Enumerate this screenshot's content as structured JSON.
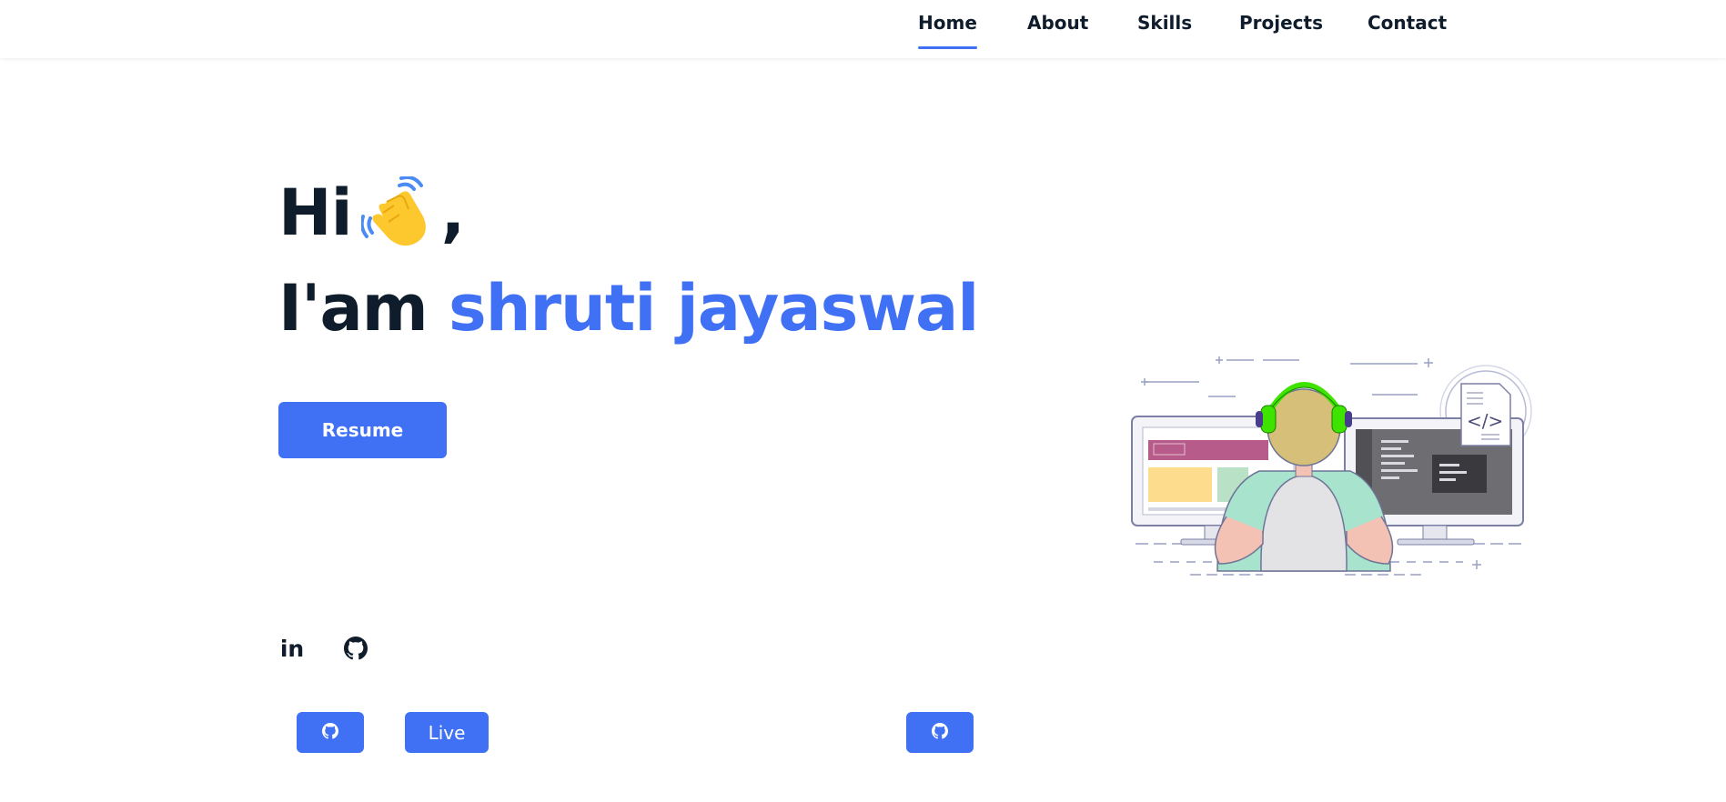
{
  "nav": {
    "items": [
      {
        "label": "Home",
        "active": true
      },
      {
        "label": "About",
        "active": false
      },
      {
        "label": "Skills",
        "active": false
      },
      {
        "label": "Projects",
        "active": false
      },
      {
        "label": "Contact",
        "active": false
      }
    ]
  },
  "hero": {
    "greeting": "Hi",
    "greeting_emoji": "waving-hand-icon",
    "greeting_suffix": ",",
    "intro": "I'am",
    "name": "shruti jayaswal",
    "resume_label": "Resume"
  },
  "social": {
    "linkedin_label": "in",
    "linkedin_icon": "linkedin-icon",
    "github_icon": "github-icon"
  },
  "project_buttons": {
    "github_icon": "github-icon",
    "live_label": "Live"
  },
  "colors": {
    "accent": "#4070f4",
    "text": "#0f1c2b",
    "background": "#ffffff"
  }
}
